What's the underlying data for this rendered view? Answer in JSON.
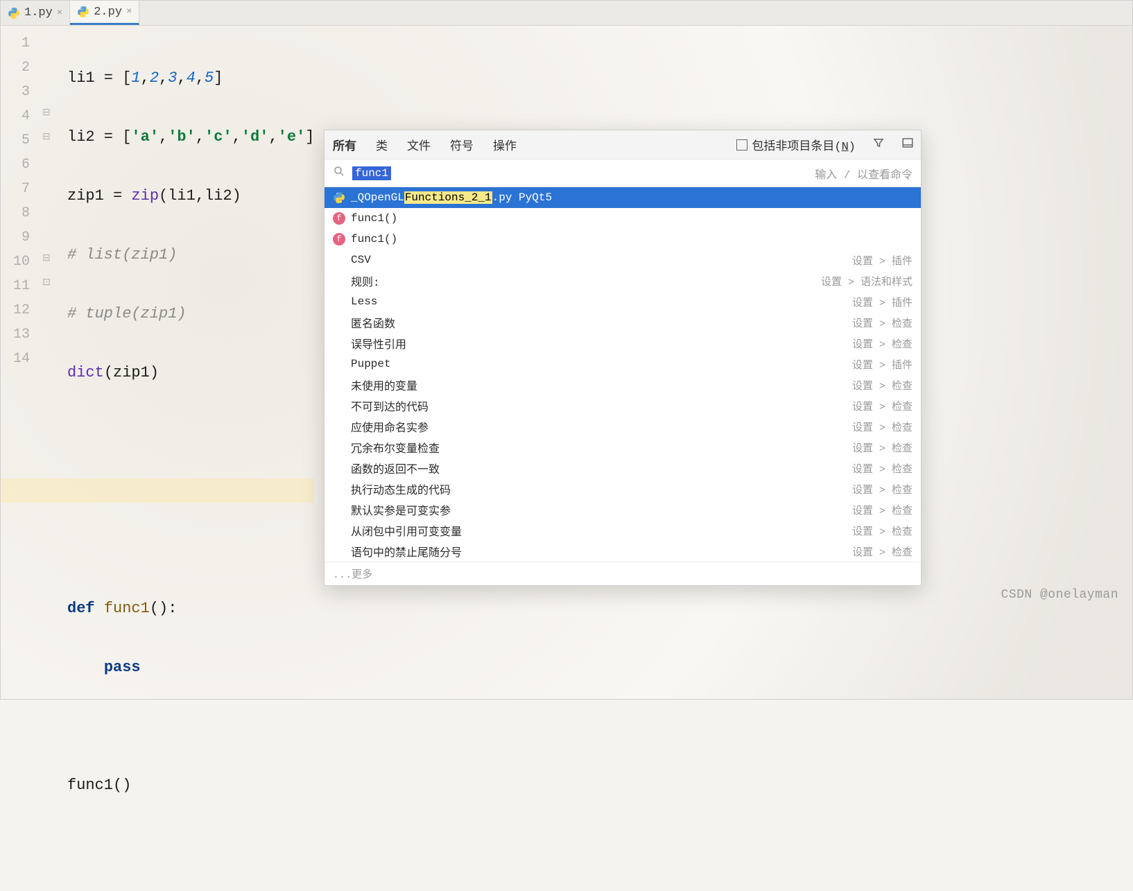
{
  "tabs": [
    {
      "name": "1.py"
    },
    {
      "name": "2.py"
    }
  ],
  "active_tab_index": 1,
  "gutter_lines": [
    "1",
    "2",
    "3",
    "4",
    "5",
    "6",
    "7",
    "8",
    "9",
    "10",
    "11",
    "12",
    "13",
    "14"
  ],
  "code": {
    "l1_pre": "li1 = [",
    "l1_nums": [
      "1",
      "2",
      "3",
      "4",
      "5"
    ],
    "l1_post": "]",
    "l2_pre": "li2 = [",
    "l2_strs": [
      "'a'",
      "'b'",
      "'c'",
      "'d'",
      "'e'"
    ],
    "l2_post": "]",
    "l3_pre": "zip1 = ",
    "l3_fn": "zip",
    "l3_args": "(li1,li2)",
    "l4_comment": "# list(zip1)",
    "l5_comment": "# tuple(zip1)",
    "l6_builtin": "dict",
    "l6_args": "(zip1)",
    "l10_def": "def ",
    "l10_name": "func1",
    "l10_sig": "():",
    "l11_pass": "pass",
    "l13_call": "func1()"
  },
  "popup": {
    "tabs": [
      "所有",
      "类",
      "文件",
      "符号",
      "操作"
    ],
    "checkbox_label": "包括非项目条目(",
    "checkbox_mn": "N",
    "checkbox_close": ")",
    "query": "func1",
    "hint": "输入 / 以查看命令",
    "results": [
      {
        "type": "file",
        "pre": "_QOpenGL",
        "hl": "Functions_2_1",
        "post": ".py PyQt5",
        "path": ""
      },
      {
        "type": "func",
        "label": "func1()",
        "path": ""
      },
      {
        "type": "func",
        "label": "func1()",
        "path": ""
      },
      {
        "type": "plain",
        "label": "CSV",
        "path": "设置 > 插件"
      },
      {
        "type": "plain",
        "label": "规则:",
        "path": "设置 > 语法和样式"
      },
      {
        "type": "plain",
        "label": "Less",
        "path": "设置 > 插件"
      },
      {
        "type": "plain",
        "label": "匿名函数",
        "path": "设置 > 检查"
      },
      {
        "type": "plain",
        "label": "误导性引用",
        "path": "设置 > 检查"
      },
      {
        "type": "plain",
        "label": "Puppet",
        "path": "设置 > 插件"
      },
      {
        "type": "plain",
        "label": "未使用的变量",
        "path": "设置 > 检查"
      },
      {
        "type": "plain",
        "label": "不可到达的代码",
        "path": "设置 > 检查"
      },
      {
        "type": "plain",
        "label": "应使用命名实参",
        "path": "设置 > 检查"
      },
      {
        "type": "plain",
        "label": "冗余布尔变量检查",
        "path": "设置 > 检查"
      },
      {
        "type": "plain",
        "label": "函数的返回不一致",
        "path": "设置 > 检查"
      },
      {
        "type": "plain",
        "label": "执行动态生成的代码",
        "path": "设置 > 检查"
      },
      {
        "type": "plain",
        "label": "默认实参是可变实参",
        "path": "设置 > 检查"
      },
      {
        "type": "plain",
        "label": "从闭包中引用可变变量",
        "path": "设置 > 检查"
      },
      {
        "type": "plain",
        "label": "语句中的禁止尾随分号",
        "path": "设置 > 检查"
      }
    ],
    "more": "...更多"
  },
  "watermark": "CSDN @onelayman"
}
